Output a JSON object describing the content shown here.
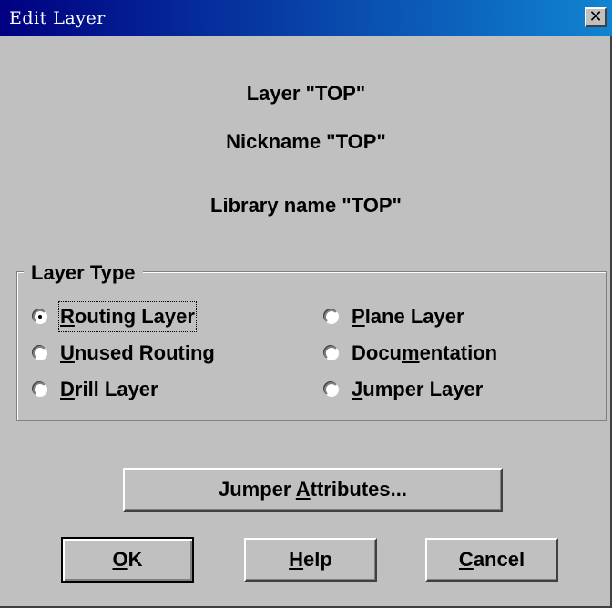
{
  "window": {
    "title": "Edit Layer",
    "close_glyph": "✕"
  },
  "info": {
    "layer": "Layer \"TOP\"",
    "nickname": "Nickname \"TOP\"",
    "library_name": "Library name \"TOP\""
  },
  "layer_type": {
    "legend": "Layer Type",
    "selected": "Routing Layer",
    "options": [
      {
        "mnemonic": "R",
        "rest": "outing Layer",
        "checked": true
      },
      {
        "mnemonic": "P",
        "rest": "lane Layer",
        "checked": false
      },
      {
        "mnemonic": "U",
        "rest": "nused Routing",
        "checked": false
      },
      {
        "pre": "Docu",
        "mnemonic": "m",
        "rest": "entation",
        "checked": false
      },
      {
        "mnemonic": "D",
        "rest": "rill Layer",
        "checked": false
      },
      {
        "mnemonic": "J",
        "rest": "umper Layer",
        "checked": false
      }
    ]
  },
  "buttons": {
    "jumper_attributes": {
      "pre": "Jumper ",
      "mnemonic": "A",
      "rest": "ttributes..."
    },
    "ok": {
      "mnemonic": "O",
      "rest": "K"
    },
    "help": {
      "mnemonic": "H",
      "rest": "elp"
    },
    "cancel": {
      "mnemonic": "C",
      "rest": "ancel"
    }
  },
  "colors": {
    "face": "#c0c0c0",
    "title_start": "#000080",
    "title_end": "#1084d0"
  }
}
